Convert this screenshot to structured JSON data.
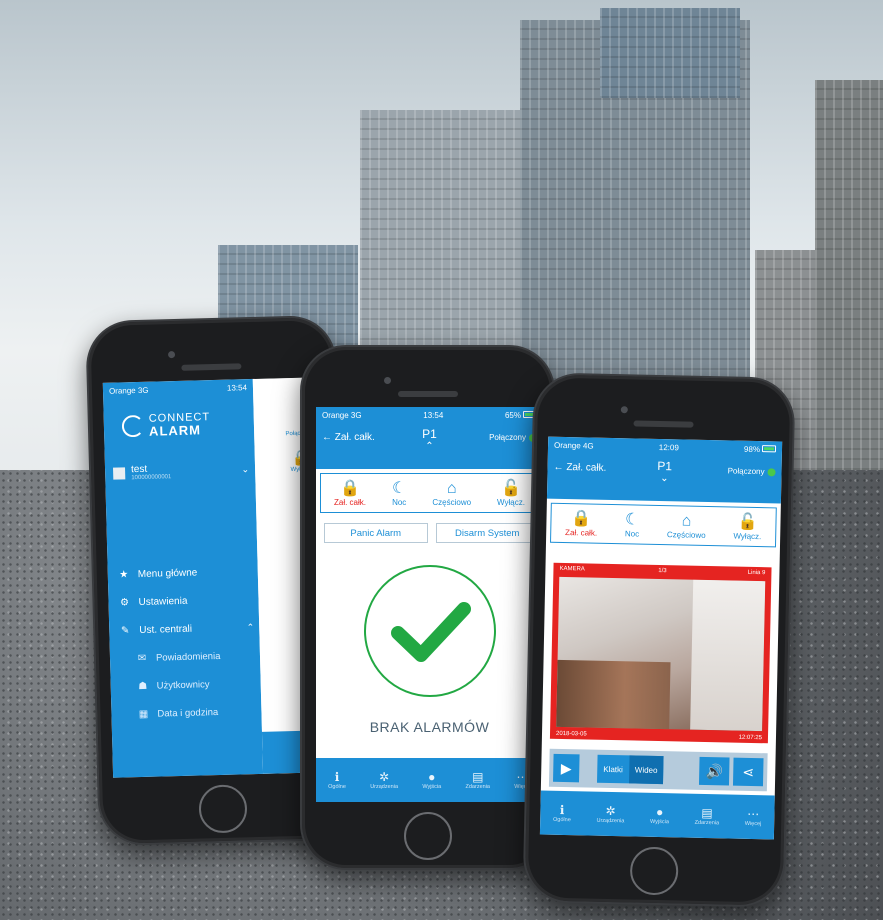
{
  "phone1": {
    "status": {
      "carrier": "Orange",
      "network": "3G",
      "time": "13:54",
      "battery": "65%"
    },
    "logo": {
      "line1": "CONNECT",
      "line2": "ALARM"
    },
    "user": {
      "name": "test",
      "id": "100000000001"
    },
    "menu": [
      {
        "label": "Menu główne",
        "icon": "star-icon",
        "glyph": "★"
      },
      {
        "label": "Ustawienia",
        "icon": "gear-icon",
        "glyph": "⚙"
      },
      {
        "label": "Ust. centrali",
        "icon": "wrench-icon",
        "glyph": "✎"
      },
      {
        "label": "Powiadomienia",
        "icon": "envelope-icon",
        "glyph": "✉"
      },
      {
        "label": "Użytkownicy",
        "icon": "users-icon",
        "glyph": "☗"
      },
      {
        "label": "Data i godzina",
        "icon": "calendar-icon",
        "glyph": "▦"
      }
    ],
    "behind": {
      "connected": "Połączony",
      "disarm": "Wyłącz.",
      "more": "..."
    }
  },
  "phone2": {
    "status": {
      "carrier": "Orange",
      "network": "3G",
      "time": "13:54",
      "battery": "65%"
    },
    "header": {
      "back": "Zał. całk.",
      "title": "P1",
      "connected": "Połączony"
    },
    "modes": [
      {
        "label": "Zał. całk.",
        "icon": "lock-closed-icon",
        "glyph": "🔒",
        "color": "#e52421"
      },
      {
        "label": "Noc",
        "icon": "moon-icon",
        "glyph": "☾",
        "color": "#1d8fd6"
      },
      {
        "label": "Częściowo",
        "icon": "home-icon",
        "glyph": "⌂",
        "color": "#1d8fd6"
      },
      {
        "label": "Wyłącz.",
        "icon": "lock-open-icon",
        "glyph": "🔓",
        "color": "#1d8fd6"
      }
    ],
    "panic": "Panic Alarm",
    "disarm": "Disarm System",
    "status_text": "BRAK ALARMÓW",
    "tabs": [
      {
        "label": "Ogólne",
        "icon": "info-icon",
        "glyph": "ℹ"
      },
      {
        "label": "Urządzenia",
        "icon": "devices-icon",
        "glyph": "✲"
      },
      {
        "label": "Wyjścia",
        "icon": "bulb-icon",
        "glyph": "●"
      },
      {
        "label": "Zdarzenia",
        "icon": "list-icon",
        "glyph": "▤"
      },
      {
        "label": "Więcej",
        "icon": "more-icon",
        "glyph": "⋯"
      }
    ]
  },
  "phone3": {
    "status": {
      "carrier": "Orange",
      "network": "4G",
      "time": "12:09",
      "battery": "98%"
    },
    "header": {
      "back": "Zał. całk.",
      "title": "P1",
      "connected": "Połączony"
    },
    "modes": [
      {
        "label": "Zał. całk.",
        "icon": "lock-closed-icon",
        "glyph": "🔒",
        "color": "#e52421"
      },
      {
        "label": "Noc",
        "icon": "moon-icon",
        "glyph": "☾",
        "color": "#1d8fd6"
      },
      {
        "label": "Częściowo",
        "icon": "home-icon",
        "glyph": "⌂",
        "color": "#1d8fd6"
      },
      {
        "label": "Wyłącz.",
        "icon": "lock-open-icon",
        "glyph": "🔓",
        "color": "#1d8fd6"
      }
    ],
    "camera": {
      "label": "KAMERA",
      "counter": "1/3",
      "line": "Linia 9",
      "date": "2018-03-05",
      "time": "12:07:25"
    },
    "controls": {
      "frames": "Klatki",
      "video": "Wideo"
    },
    "tabs": [
      {
        "label": "Ogólne",
        "icon": "info-icon",
        "glyph": "ℹ"
      },
      {
        "label": "Urządzenia",
        "icon": "devices-icon",
        "glyph": "✲"
      },
      {
        "label": "Wyjścia",
        "icon": "bulb-icon",
        "glyph": "●"
      },
      {
        "label": "Zdarzenia",
        "icon": "list-icon",
        "glyph": "▤"
      },
      {
        "label": "Więcej",
        "icon": "more-icon",
        "glyph": "⋯"
      }
    ]
  },
  "colors": {
    "brand": "#1d8fd6",
    "alert": "#e52421",
    "ok": "#22a843"
  }
}
